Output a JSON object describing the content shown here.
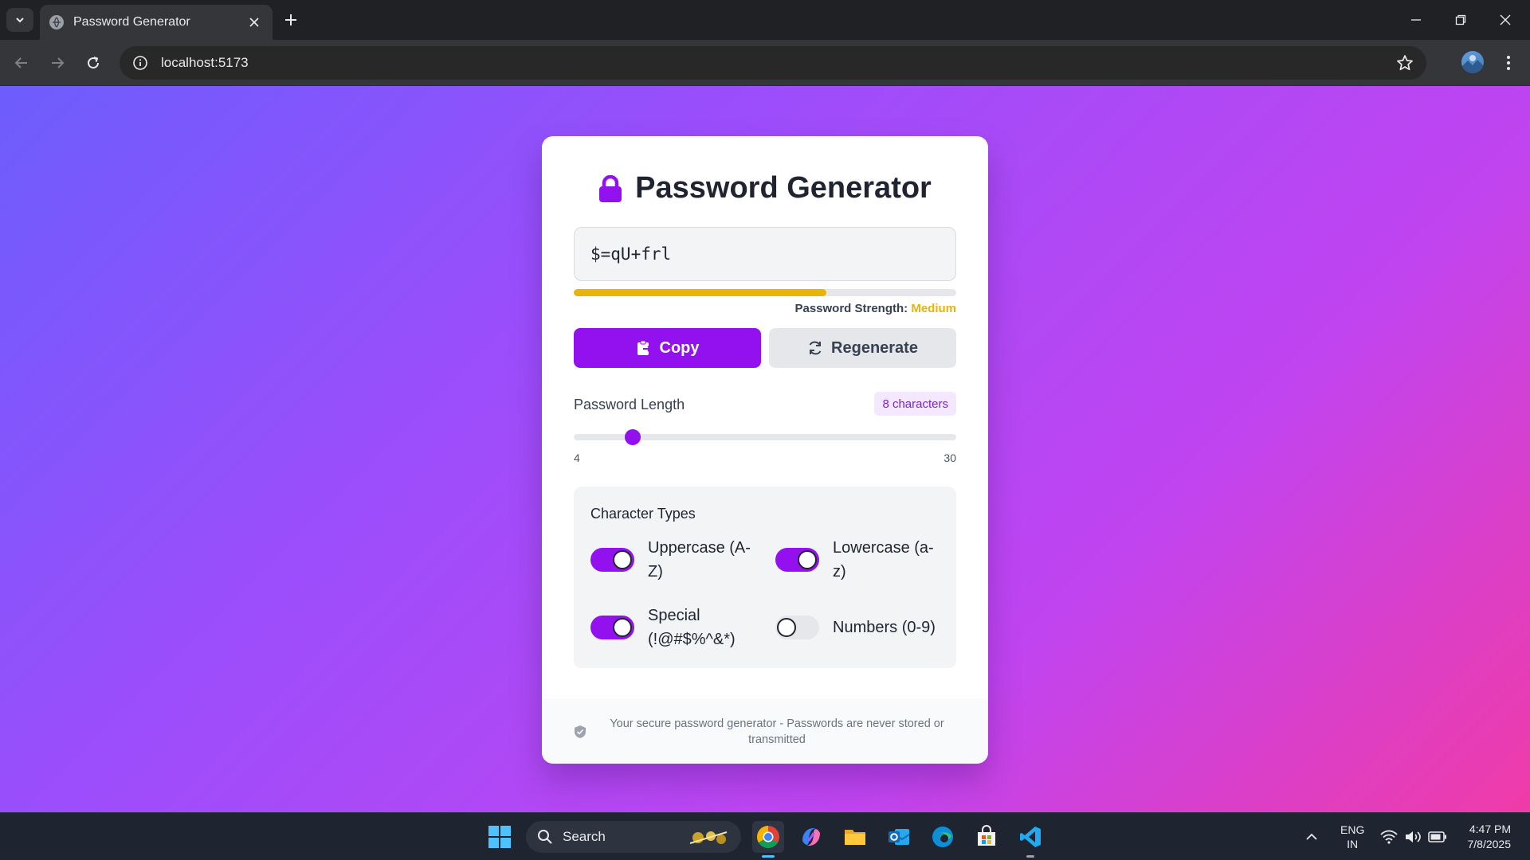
{
  "browser": {
    "tab_title": "Password Generator",
    "url": "localhost:5173"
  },
  "app": {
    "title": "Password Generator",
    "password": "$=qU+frl",
    "strength": {
      "label": "Password Strength:",
      "value": "Medium",
      "fraction": 0.66,
      "color": "#eab308"
    },
    "buttons": {
      "copy": "Copy",
      "regenerate": "Regenerate"
    },
    "length": {
      "label": "Password Length",
      "badge": "8 characters",
      "value": 8,
      "min": 4,
      "max": 30,
      "min_label": "4",
      "max_label": "30"
    },
    "character_types": {
      "title": "Character Types",
      "options": [
        {
          "label": "Uppercase (A-Z)",
          "enabled": true
        },
        {
          "label": "Lowercase (a-z)",
          "enabled": true
        },
        {
          "label": "Special (!@#$%^&*)",
          "enabled": true
        },
        {
          "label": "Numbers (0-9)",
          "enabled": false
        }
      ]
    },
    "footer": "Your secure password generator - Passwords are never stored or transmitted",
    "accent_color": "#9311ee"
  },
  "taskbar": {
    "search_label": "Search",
    "language": "ENG",
    "region": "IN",
    "time": "4:47 PM",
    "date": "7/8/2025",
    "apps": [
      "start-icon",
      "chrome-icon",
      "copilot-icon",
      "file-explorer-icon",
      "outlook-icon",
      "edge-icon",
      "microsoft-store-icon",
      "vscode-icon"
    ]
  }
}
